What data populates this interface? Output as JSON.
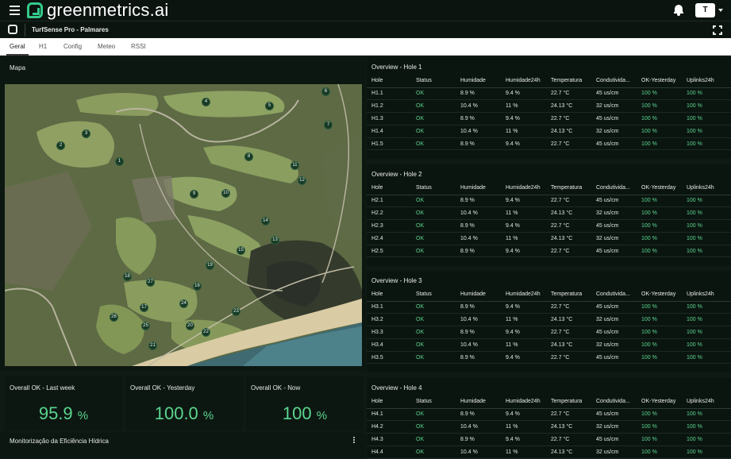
{
  "header": {
    "brand_green": "green",
    "brand_rest": "metrics.ai",
    "user_initial": "T",
    "accent_color": "#33c98a"
  },
  "subheader": {
    "title": "TurfSense Pro - Palmares"
  },
  "tabs": [
    "Geral",
    "H1",
    "Config",
    "Meteo",
    "RSSI"
  ],
  "active_tab": "Geral",
  "map": {
    "title": "Mapa",
    "markers": [
      "1",
      "2",
      "3",
      "4",
      "5",
      "6",
      "7",
      "8",
      "9",
      "10",
      "11",
      "12",
      "13",
      "14",
      "15",
      "16",
      "17",
      "18",
      "19",
      "20",
      "21",
      "22",
      "23",
      "24",
      "25",
      "26",
      "27"
    ]
  },
  "stats": [
    {
      "label": "Overall OK - Last week",
      "value": "95.9",
      "unit": "%"
    },
    {
      "label": "Overall OK - Yesterday",
      "value": "100.0",
      "unit": "%"
    },
    {
      "label": "Overall OK - Now",
      "value": "100",
      "unit": "%"
    }
  ],
  "bottom_panel": {
    "title": "Monitorização da Eficiência Hídrica"
  },
  "overview_columns": [
    "Hole",
    "Status",
    "Humidade",
    "Humidade24h",
    "Temperatura",
    "Condutividа...",
    "OK-Yesterday",
    "Uplinks24h"
  ],
  "overviews": [
    {
      "title": "Overview - Hole 1",
      "rows": [
        [
          "H1.1",
          "OK",
          "8.9 %",
          "9.4 %",
          "22.7 °C",
          "45 us/cm",
          "100 %",
          "100 %"
        ],
        [
          "H1.2",
          "OK",
          "10.4 %",
          "11 %",
          "24.13 °C",
          "32 us/cm",
          "100 %",
          "100 %"
        ],
        [
          "H1.3",
          "OK",
          "8.9 %",
          "9.4 %",
          "22.7 °C",
          "45 us/cm",
          "100 %",
          "100 %"
        ],
        [
          "H1.4",
          "OK",
          "10.4 %",
          "11 %",
          "24.13 °C",
          "32 us/cm",
          "100 %",
          "100 %"
        ],
        [
          "H1.5",
          "OK",
          "8.9 %",
          "9.4 %",
          "22.7 °C",
          "45 us/cm",
          "100 %",
          "100 %"
        ]
      ]
    },
    {
      "title": "Overview - Hole 2",
      "rows": [
        [
          "H2.1",
          "OK",
          "8.9 %",
          "9.4 %",
          "22.7 °C",
          "45 us/cm",
          "100 %",
          "100 %"
        ],
        [
          "H2.2",
          "OK",
          "10.4 %",
          "11 %",
          "24.13 °C",
          "32 us/cm",
          "100 %",
          "100 %"
        ],
        [
          "H2.3",
          "OK",
          "8.9 %",
          "9.4 %",
          "22.7 °C",
          "45 us/cm",
          "100 %",
          "100 %"
        ],
        [
          "H2.4",
          "OK",
          "10.4 %",
          "11 %",
          "24.13 °C",
          "32 us/cm",
          "100 %",
          "100 %"
        ],
        [
          "H2.5",
          "OK",
          "8.9 %",
          "9.4 %",
          "22.7 °C",
          "45 us/cm",
          "100 %",
          "100 %"
        ]
      ]
    },
    {
      "title": "Overview - Hole 3",
      "rows": [
        [
          "H3.1",
          "OK",
          "8.9 %",
          "9.4 %",
          "22.7 °C",
          "45 us/cm",
          "100 %",
          "100 %"
        ],
        [
          "H3.2",
          "OK",
          "10.4 %",
          "11 %",
          "24.13 °C",
          "32 us/cm",
          "100 %",
          "100 %"
        ],
        [
          "H3.3",
          "OK",
          "8.9 %",
          "9.4 %",
          "22.7 °C",
          "45 us/cm",
          "100 %",
          "100 %"
        ],
        [
          "H3.4",
          "OK",
          "10.4 %",
          "11 %",
          "24.13 °C",
          "32 us/cm",
          "100 %",
          "100 %"
        ],
        [
          "H3.5",
          "OK",
          "8.9 %",
          "9.4 %",
          "22.7 °C",
          "45 us/cm",
          "100 %",
          "100 %"
        ]
      ]
    },
    {
      "title": "Overview - Hole 4",
      "rows": [
        [
          "H4.1",
          "OK",
          "8.9 %",
          "9.4 %",
          "22.7 °C",
          "45 us/cm",
          "100 %",
          "100 %"
        ],
        [
          "H4.2",
          "OK",
          "10.4 %",
          "11 %",
          "24.13 °C",
          "32 us/cm",
          "100 %",
          "100 %"
        ],
        [
          "H4.3",
          "OK",
          "8.9 %",
          "9.4 %",
          "22.7 °C",
          "45 us/cm",
          "100 %",
          "100 %"
        ],
        [
          "H4.4",
          "OK",
          "10.4 %",
          "11 %",
          "24.13 °C",
          "32 us/cm",
          "100 %",
          "100 %"
        ]
      ]
    }
  ]
}
